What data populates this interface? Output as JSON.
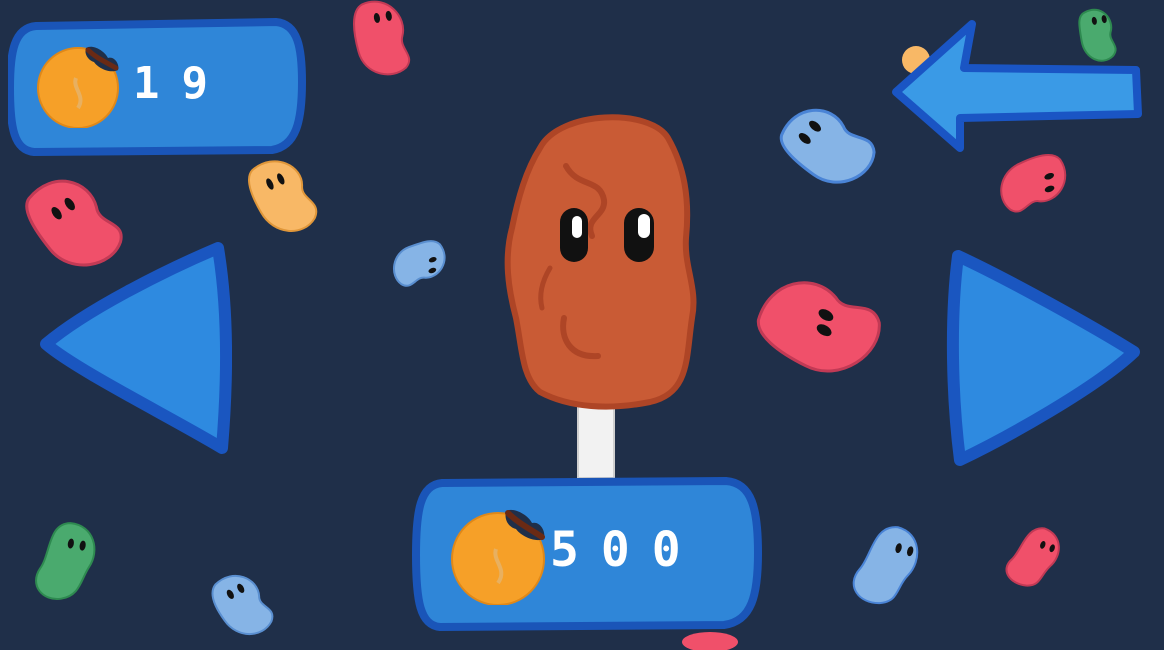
{
  "hud": {
    "coin_count": "19",
    "coin_icon": "bitten-cookie-coin-icon"
  },
  "shop": {
    "item": "chocolate-popsicle-character",
    "price": "500",
    "price_icon": "bitten-cookie-coin-icon"
  },
  "controls": {
    "back_icon": "arrow-left-icon",
    "prev_icon": "triangle-left-icon",
    "next_icon": "triangle-right-icon"
  },
  "colors": {
    "background": "#1f2f49",
    "panel_fill": "#2f86d8",
    "panel_border": "#1a55b8",
    "button_fill": "#2e8ae0",
    "button_border": "#1a56c0",
    "popsicle": "#c95b35",
    "popsicle_dark": "#ae4526",
    "coin": "#f6a028",
    "bean_red": "#f0506a",
    "bean_yellow": "#f8b866",
    "bean_blue": "#86b4e6",
    "bean_green": "#4aaa6e"
  }
}
